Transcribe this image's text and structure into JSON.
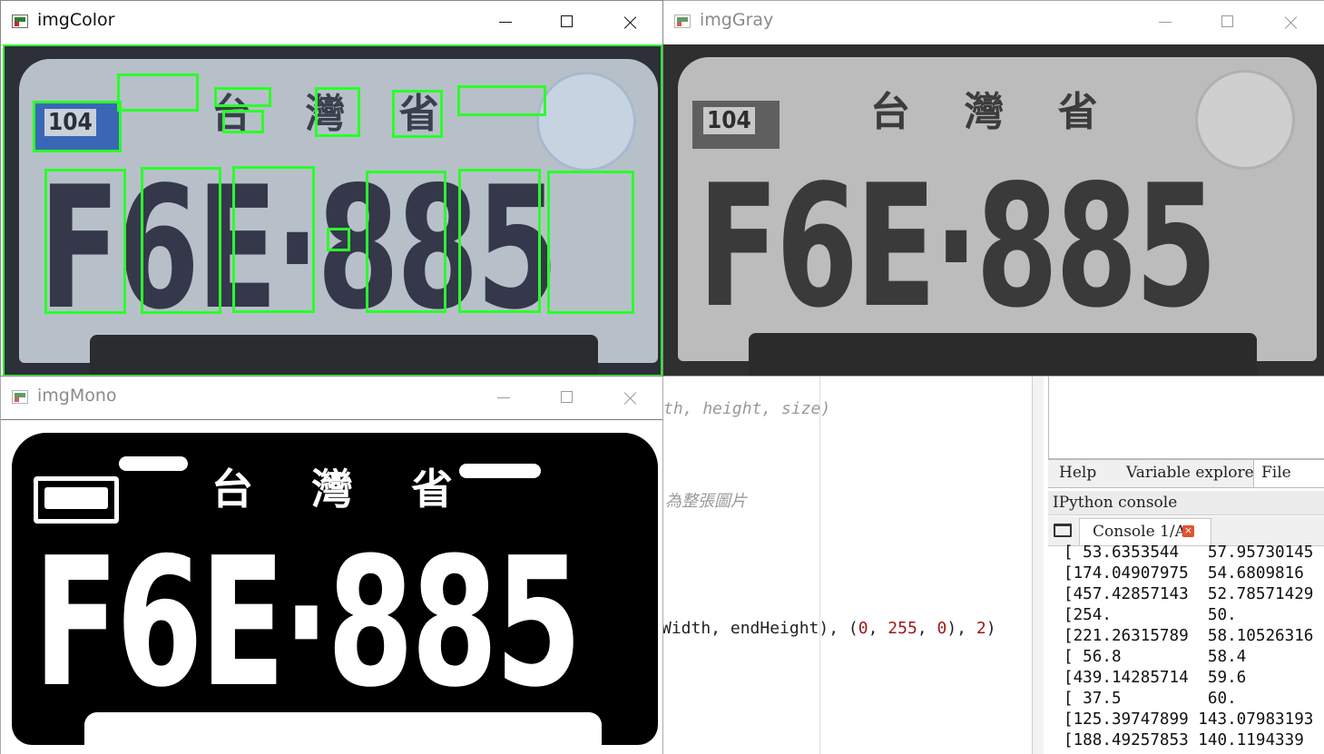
{
  "windows": {
    "color": {
      "title": "imgColor"
    },
    "gray": {
      "title": "imgGray"
    },
    "mono": {
      "title": "imgMono"
    }
  },
  "plate": {
    "registration": "F6E·885",
    "region_code": "104",
    "province_text": "台 灣 省"
  },
  "mono_plate": {
    "registration": "F6E·885",
    "province_text": "台 灣 省"
  },
  "editor": {
    "line1": "th, height, size)",
    "line2": "為整張圖片",
    "line3_a": "Width, endHeight), (",
    "line3_n1": "0",
    "line3_c1": ", ",
    "line3_n2": "255",
    "line3_c2": ", ",
    "line3_n3": "0",
    "line3_b": "), ",
    "line3_n4": "2",
    "line3_c": ")"
  },
  "panel": {
    "tabs": [
      "Help",
      "Variable explorer",
      "File expl"
    ],
    "console_title": "IPython console",
    "console_tab": "Console 1/A",
    "console_lines": [
      "[ 53.6353544   57.95730145",
      "[174.04907975  54.6809816",
      "[457.42857143  52.78571429",
      "[254.          50.",
      "[221.26315789  58.10526316",
      "[ 56.8         58.4",
      "[439.14285714  59.6",
      "[ 37.5         60.",
      "[125.39747899 143.07983193",
      "[188.49257853 140.1194339"
    ]
  }
}
